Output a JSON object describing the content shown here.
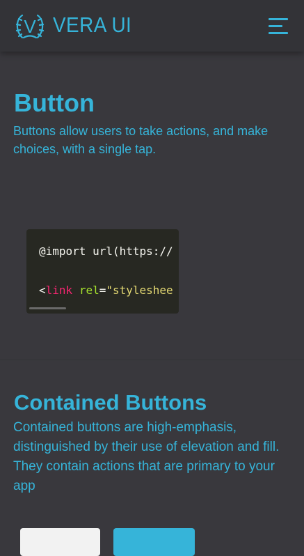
{
  "header": {
    "brand": "VERA UI",
    "logo_letter": "V",
    "menu_icon": "hamburger-menu-icon"
  },
  "colors": {
    "accent": "#36b4d9",
    "background": "#39383d",
    "header_bg": "#333337",
    "code_bg": "#272822"
  },
  "intro": {
    "title": "Button",
    "description": "Buttons allow users to take actions, and make choices, with a single tap."
  },
  "code": {
    "line1": "@import url(https://",
    "line2_open": "<",
    "line2_tag": "link",
    "line2_attr": "rel",
    "line2_eq": "=",
    "line2_str": "\"styleshee"
  },
  "contained": {
    "title": "Contained Buttons",
    "description": "Contained buttons are high-emphasis, distinguished by their use of elevation and fill. They contain actions that are primary to your app"
  }
}
